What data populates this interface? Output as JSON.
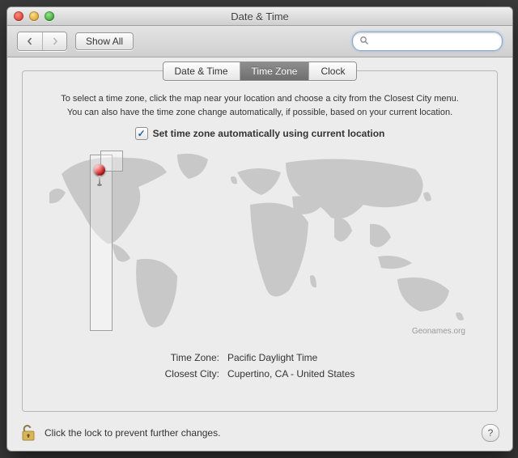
{
  "window": {
    "title": "Date & Time"
  },
  "toolbar": {
    "show_all_label": "Show All",
    "search_placeholder": ""
  },
  "tabs": {
    "date_time": "Date & Time",
    "time_zone": "Time Zone",
    "clock": "Clock"
  },
  "instructions": {
    "line1": "To select a time zone, click the map near your location and choose a city from the Closest City menu.",
    "line2": "You can also have the time zone change automatically, if possible, based on your current location."
  },
  "checkbox": {
    "label": "Set time zone automatically using current location",
    "checked_glyph": "✓"
  },
  "map": {
    "attribution": "Geonames.org"
  },
  "info": {
    "tz_key": "Time Zone:",
    "tz_value": "Pacific Daylight Time",
    "city_key": "Closest City:",
    "city_value": "Cupertino, CA - United States"
  },
  "footer": {
    "lock_text": "Click the lock to prevent further changes.",
    "help_glyph": "?"
  }
}
